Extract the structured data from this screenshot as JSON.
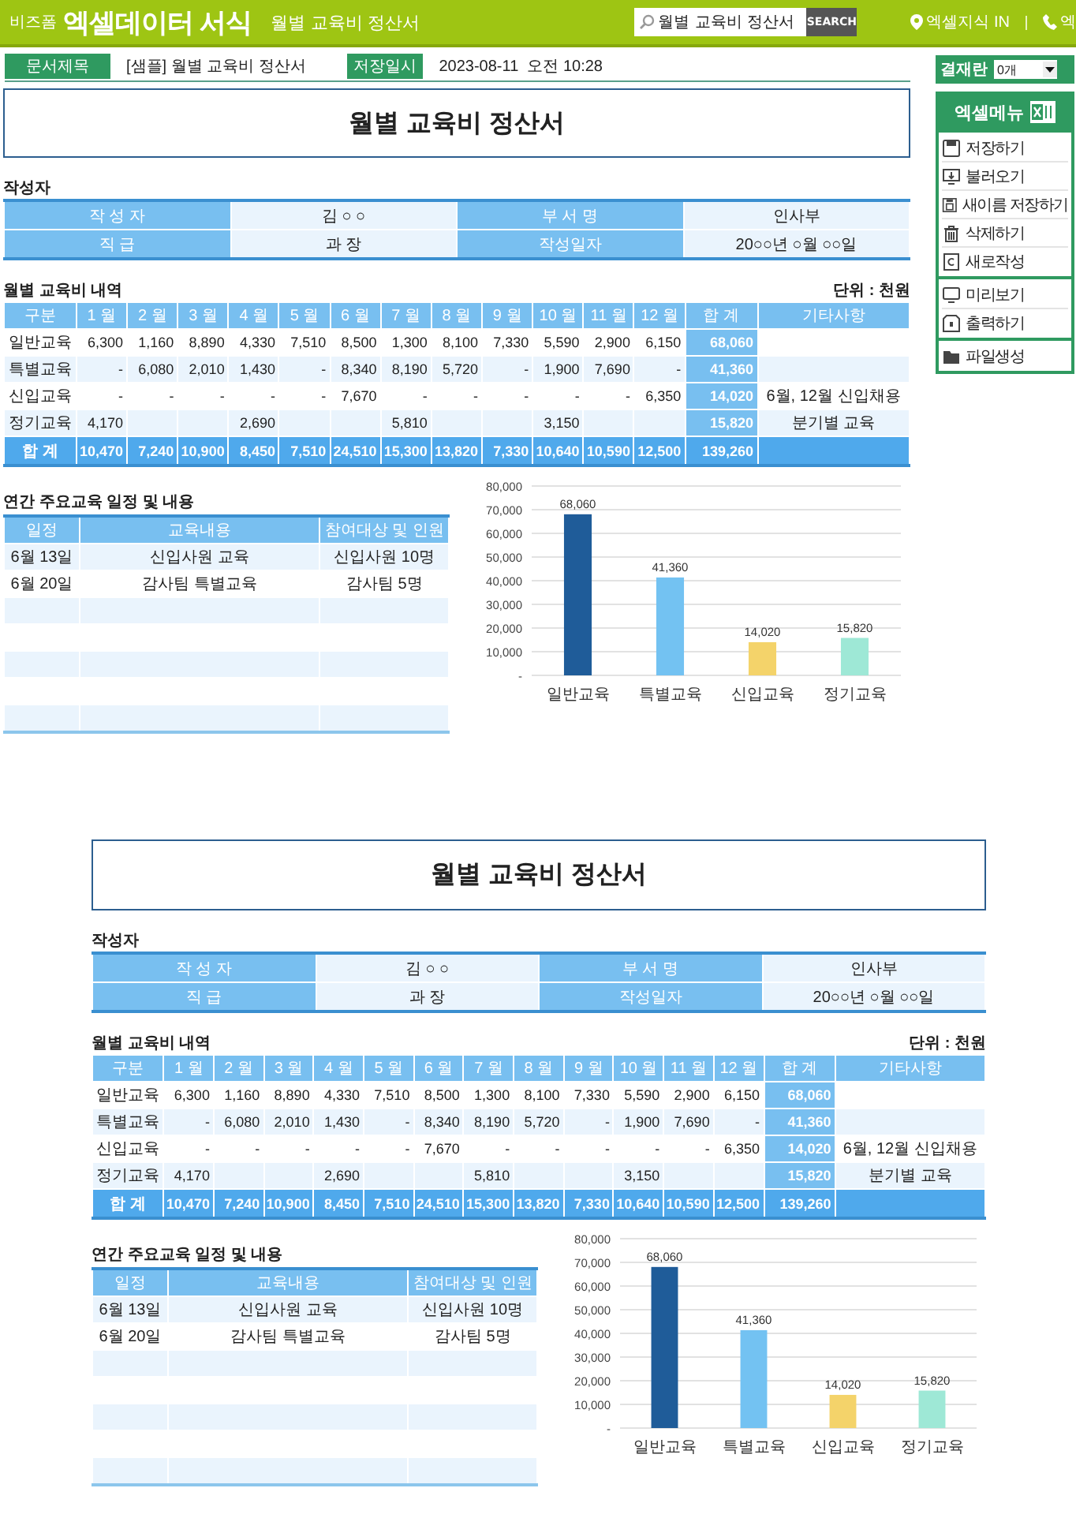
{
  "header": {
    "brand_small": "비즈폼",
    "brand": "엑셀데이터 서식",
    "page_title": "월별 교육비 정산서",
    "search": {
      "value": "월별 교육비 정산서",
      "button": "SEARCH"
    },
    "links": [
      {
        "kind": "pin",
        "label": "엑셀지식 IN"
      },
      {
        "kind": "phone",
        "label": "엑"
      }
    ]
  },
  "doc_info": [
    {
      "label": "문서제목",
      "value": "[샘플] 월별 교육비 정산서"
    },
    {
      "label": "저장일시",
      "value": "2023-08-11  오전 10:28"
    }
  ],
  "approval": {
    "label": "결재란",
    "value": "0개"
  },
  "menu": {
    "title": "엑셀메뉴",
    "groups": [
      [
        {
          "kind": "save",
          "label": "저장하기"
        },
        {
          "kind": "load",
          "label": "불러오기"
        },
        {
          "kind": "saveas",
          "label": "새이름 저장하기"
        },
        {
          "kind": "delete",
          "label": "삭제하기"
        },
        {
          "kind": "new",
          "label": "새로작성"
        }
      ],
      [
        {
          "kind": "preview",
          "label": "미리보기"
        },
        {
          "kind": "print",
          "label": "출력하기"
        }
      ],
      [
        {
          "kind": "folder",
          "label": "파일생성"
        }
      ]
    ]
  },
  "documents": [
    {
      "title": "월별 교육비 정산서",
      "author": {
        "heading": "작성자",
        "rows": [
          [
            "작 성 자",
            "김 ○ ○",
            "부 서 명",
            "인사부"
          ],
          [
            "직      급",
            "과 장",
            "작성일자",
            "20○○년 ○월 ○○일"
          ]
        ]
      },
      "monthly": {
        "heading": "월별 교육비 내역",
        "unit": "단위 : 천원",
        "columns": [
          "구분",
          "1 월",
          "2 월",
          "3 월",
          "4 월",
          "5 월",
          "6 월",
          "7 월",
          "8 월",
          "9 월",
          "10 월",
          "11 월",
          "12 월",
          "합 계",
          "기타사항"
        ],
        "rows": [
          [
            "일반교육",
            "6,300",
            "1,160",
            "8,890",
            "4,330",
            "7,510",
            "8,500",
            "1,300",
            "8,100",
            "7,330",
            "5,590",
            "2,900",
            "6,150",
            "68,060",
            null
          ],
          [
            "특별교육",
            "-",
            "6,080",
            "2,010",
            "1,430",
            "-",
            "8,340",
            "8,190",
            "5,720",
            "-",
            "1,900",
            "7,690",
            "-",
            "41,360",
            null
          ],
          [
            "신입교육",
            "-",
            "-",
            "-",
            "-",
            "-",
            "7,670",
            "-",
            "-",
            "-",
            "-",
            "-",
            "6,350",
            "14,020",
            "6월, 12월 신입채용"
          ],
          [
            "정기교육",
            "4,170",
            null,
            null,
            "2,690",
            null,
            null,
            "5,810",
            null,
            null,
            "3,150",
            null,
            null,
            "15,820",
            "분기별 교육"
          ]
        ],
        "total": [
          "합 계",
          "10,470",
          "7,240",
          "10,900",
          "8,450",
          "7,510",
          "24,510",
          "15,300",
          "13,820",
          "7,330",
          "10,640",
          "10,590",
          "12,500",
          "139,260"
        ]
      },
      "schedule": {
        "heading": "연간 주요교육 일정 및 내용",
        "columns": [
          "일정",
          "교육내용",
          "참여대상 및 인원"
        ],
        "rows": [
          [
            "6월 13일",
            "신입사원 교육",
            "신입사원 10명"
          ],
          [
            "6월 20일",
            "감사팀 특별교육",
            "감사팀 5명"
          ],
          [
            null,
            null,
            null
          ],
          [
            null,
            null,
            null
          ],
          [
            null,
            null,
            null
          ],
          [
            null,
            null,
            null
          ],
          [
            null,
            null,
            null
          ]
        ]
      },
      "chart_data": {
        "type": "bar",
        "categories": [
          "일반교육",
          "특별교육",
          "신입교육",
          "정기교육"
        ],
        "series": [
          {
            "values": [
              68060,
              41360,
              14020,
              15820
            ],
            "colors": [
              "#1f5c99",
              "#73c2f2",
              "#f4d36a",
              "#9ee8d6"
            ]
          }
        ],
        "ylim": [
          0,
          80000
        ],
        "yticks": [
          {
            "value": 0,
            "label": "-"
          },
          {
            "value": 10000,
            "label": "10,000"
          },
          {
            "value": 20000,
            "label": "20,000"
          },
          {
            "value": 30000,
            "label": "30,000"
          },
          {
            "value": 40000,
            "label": "40,000"
          },
          {
            "value": 50000,
            "label": "50,000"
          },
          {
            "value": 60000,
            "label": "60,000"
          },
          {
            "value": 70000,
            "label": "70,000"
          },
          {
            "value": 80000,
            "label": "80,000"
          }
        ],
        "value_labels": [
          "68,060",
          "41,360",
          "14,020",
          "15,820"
        ],
        "grid": true
      }
    },
    {
      "title": "월별 교육비 정산서",
      "author": {
        "heading": "작성자",
        "rows": [
          [
            "작 성 자",
            "김 ○ ○",
            "부 서 명",
            "인사부"
          ],
          [
            "직      급",
            "과 장",
            "작성일자",
            "20○○년 ○월 ○○일"
          ]
        ]
      },
      "monthly": {
        "heading": "월별 교육비 내역",
        "unit": "단위 : 천원",
        "columns": [
          "구분",
          "1 월",
          "2 월",
          "3 월",
          "4 월",
          "5 월",
          "6 월",
          "7 월",
          "8 월",
          "9 월",
          "10 월",
          "11 월",
          "12 월",
          "합 계",
          "기타사항"
        ],
        "rows": [
          [
            "일반교육",
            "6,300",
            "1,160",
            "8,890",
            "4,330",
            "7,510",
            "8,500",
            "1,300",
            "8,100",
            "7,330",
            "5,590",
            "2,900",
            "6,150",
            "68,060",
            null
          ],
          [
            "특별교육",
            "-",
            "6,080",
            "2,010",
            "1,430",
            "-",
            "8,340",
            "8,190",
            "5,720",
            "-",
            "1,900",
            "7,690",
            "-",
            "41,360",
            null
          ],
          [
            "신입교육",
            "-",
            "-",
            "-",
            "-",
            "-",
            "7,670",
            "-",
            "-",
            "-",
            "-",
            "-",
            "6,350",
            "14,020",
            "6월, 12월 신입채용"
          ],
          [
            "정기교육",
            "4,170",
            null,
            null,
            "2,690",
            null,
            null,
            "5,810",
            null,
            null,
            "3,150",
            null,
            null,
            "15,820",
            "분기별 교육"
          ]
        ],
        "total": [
          "합 계",
          "10,470",
          "7,240",
          "10,900",
          "8,450",
          "7,510",
          "24,510",
          "15,300",
          "13,820",
          "7,330",
          "10,640",
          "10,590",
          "12,500",
          "139,260"
        ]
      },
      "schedule": {
        "heading": "연간 주요교육 일정 및 내용",
        "columns": [
          "일정",
          "교육내용",
          "참여대상 및 인원"
        ],
        "rows": [
          [
            "6월 13일",
            "신입사원 교육",
            "신입사원 10명"
          ],
          [
            "6월 20일",
            "감사팀 특별교육",
            "감사팀 5명"
          ],
          [
            null,
            null,
            null
          ],
          [
            null,
            null,
            null
          ],
          [
            null,
            null,
            null
          ],
          [
            null,
            null,
            null
          ],
          [
            null,
            null,
            null
          ]
        ]
      },
      "chart_data": {
        "type": "bar",
        "categories": [
          "일반교육",
          "특별교육",
          "신입교육",
          "정기교육"
        ],
        "series": [
          {
            "values": [
              68060,
              41360,
              14020,
              15820
            ],
            "colors": [
              "#1f5c99",
              "#73c2f2",
              "#f4d36a",
              "#9ee8d6"
            ]
          }
        ],
        "ylim": [
          0,
          80000
        ],
        "yticks": [
          {
            "value": 0,
            "label": "-"
          },
          {
            "value": 10000,
            "label": "10,000"
          },
          {
            "value": 20000,
            "label": "20,000"
          },
          {
            "value": 30000,
            "label": "30,000"
          },
          {
            "value": 40000,
            "label": "40,000"
          },
          {
            "value": 50000,
            "label": "50,000"
          },
          {
            "value": 60000,
            "label": "60,000"
          },
          {
            "value": 70000,
            "label": "70,000"
          },
          {
            "value": 80000,
            "label": "80,000"
          }
        ],
        "value_labels": [
          "68,060",
          "41,360",
          "14,020",
          "15,820"
        ],
        "grid": true
      }
    }
  ]
}
